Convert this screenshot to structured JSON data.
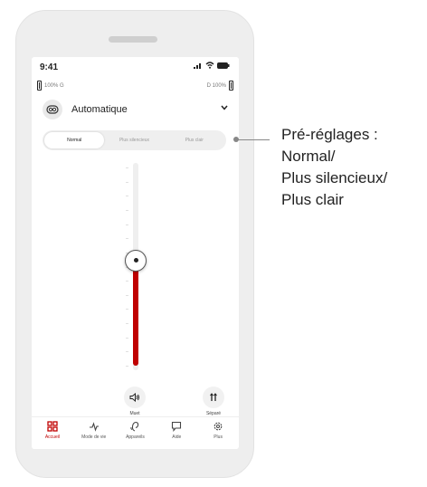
{
  "status_bar": {
    "time": "9:41"
  },
  "battery": {
    "left_text": "100% G",
    "right_text": "D 100%"
  },
  "program": {
    "name": "Automatique"
  },
  "presets": {
    "items": [
      "Normal",
      "Plus silencieux",
      "Plus clair"
    ],
    "selected": "Normal"
  },
  "volume": {
    "level_fraction": 0.53
  },
  "actions": {
    "mute_label": "Muet",
    "split_label": "Séparé"
  },
  "tabs": [
    {
      "label": "Accueil",
      "icon": "grid-icon",
      "active": true
    },
    {
      "label": "Mode de vie",
      "icon": "activity-icon",
      "active": false
    },
    {
      "label": "Appareils",
      "icon": "hearing-aid-icon",
      "active": false
    },
    {
      "label": "Aide",
      "icon": "chat-bubble-icon",
      "active": false
    },
    {
      "label": "Plus",
      "icon": "gear-icon",
      "active": false
    }
  ],
  "callout": {
    "lines": [
      "Pré-réglages :",
      "Normal/",
      "Plus silencieux/",
      "Plus clair"
    ]
  },
  "colors": {
    "accent": "#c00000",
    "track": "#efefef",
    "frame": "#eeeeee"
  }
}
